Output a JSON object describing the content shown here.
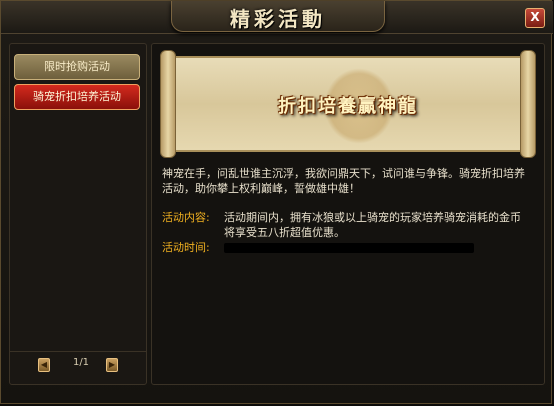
{
  "window": {
    "title": "精彩活動",
    "close_label": "X"
  },
  "sidebar": {
    "items": [
      {
        "label": "限时抢购活动",
        "state": "normal"
      },
      {
        "label": "骑宠折扣培养活动",
        "state": "active"
      }
    ],
    "pager": {
      "prev": "◀",
      "next": "▶",
      "text": "1/1"
    }
  },
  "main": {
    "banner_title": "折扣培養贏神龍",
    "description": "神宠在手，问乱世谁主沉浮，我欲问鼎天下，试问谁与争锋。骑宠折扣培养活动，助你攀上权利巅峰，誓做雄中雄！",
    "content_label": "活动内容:",
    "content_value": "活动期间内，拥有冰狼或以上骑宠的玩家培养骑宠消耗的金币将享受五八折超值优惠。",
    "time_label": "活动时间:"
  },
  "colors": {
    "accent_gold": "#f0b020",
    "active_red": "#c0201a"
  }
}
